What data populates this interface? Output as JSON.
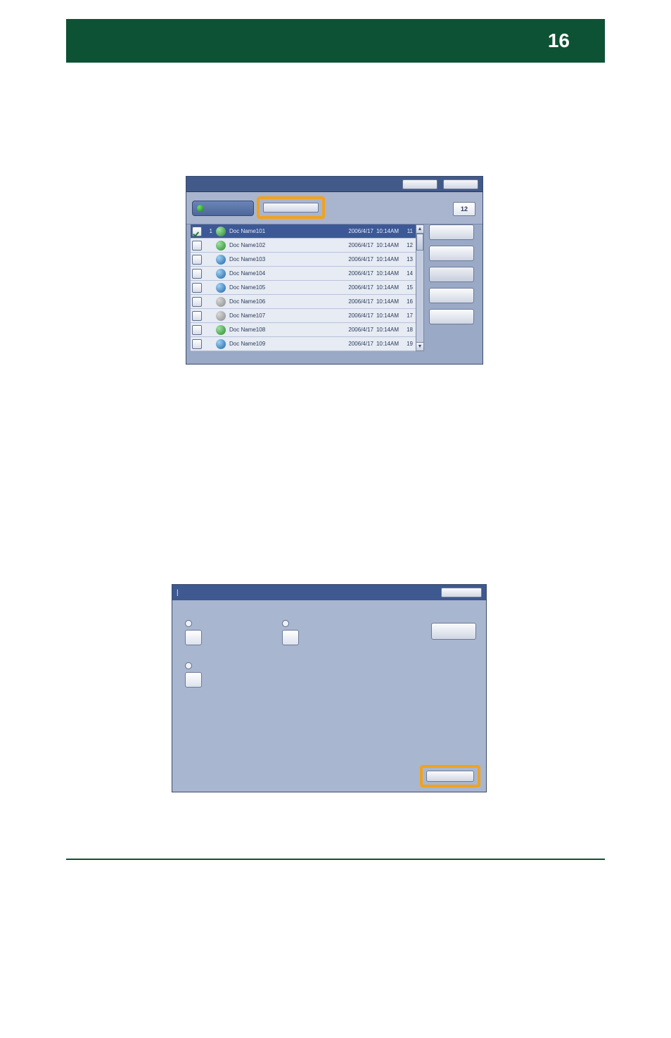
{
  "header": {
    "page_number": "16"
  },
  "panel1": {
    "pages_count": "12",
    "rows": [
      {
        "num": "1",
        "name": "Doc Name101",
        "date": "2006/4/17",
        "time": "10:14AM",
        "pg": "11",
        "checked": true,
        "selected": true,
        "icon": "a"
      },
      {
        "num": "",
        "name": "Doc Name102",
        "date": "2006/4/17",
        "time": "10:14AM",
        "pg": "12",
        "checked": false,
        "selected": false,
        "icon": "a"
      },
      {
        "num": "",
        "name": "Doc Name103",
        "date": "2006/4/17",
        "time": "10:14AM",
        "pg": "13",
        "checked": false,
        "selected": false,
        "icon": "b"
      },
      {
        "num": "",
        "name": "Doc Name104",
        "date": "2006/4/17",
        "time": "10:14AM",
        "pg": "14",
        "checked": false,
        "selected": false,
        "icon": "b"
      },
      {
        "num": "",
        "name": "Doc Name105",
        "date": "2006/4/17",
        "time": "10:14AM",
        "pg": "15",
        "checked": false,
        "selected": false,
        "icon": "b"
      },
      {
        "num": "",
        "name": "Doc Name106",
        "date": "2006/4/17",
        "time": "10:14AM",
        "pg": "16",
        "checked": false,
        "selected": false,
        "icon": "c"
      },
      {
        "num": "",
        "name": "Doc Name107",
        "date": "2006/4/17",
        "time": "10:14AM",
        "pg": "17",
        "checked": false,
        "selected": false,
        "icon": "c"
      },
      {
        "num": "",
        "name": "Doc Name108",
        "date": "2006/4/17",
        "time": "10:14AM",
        "pg": "18",
        "checked": false,
        "selected": false,
        "icon": "a"
      },
      {
        "num": "",
        "name": "Doc Name109",
        "date": "2006/4/17",
        "time": "10:14AM",
        "pg": "19",
        "checked": false,
        "selected": false,
        "icon": "b"
      }
    ]
  },
  "panel2": {
    "title_cursor": "|"
  }
}
